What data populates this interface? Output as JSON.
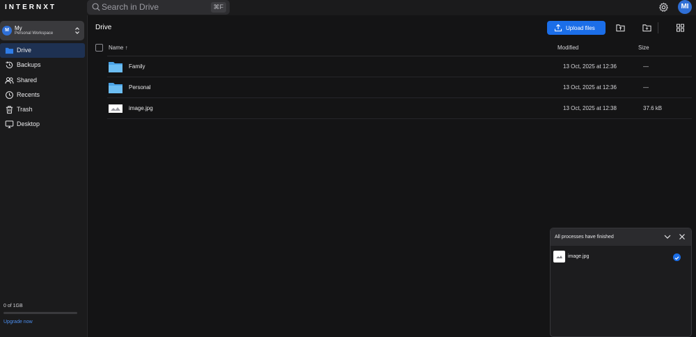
{
  "app": {
    "logo": "INTERNXT"
  },
  "search": {
    "placeholder": "Search in Drive",
    "shortcut": "⌘F"
  },
  "user": {
    "initials": "MI"
  },
  "workspace": {
    "initial": "M",
    "name": "My",
    "subtitle": "Personal Workspace"
  },
  "sidebar": {
    "items": [
      {
        "label": "Drive",
        "icon": "folder-icon",
        "active": true
      },
      {
        "label": "Backups",
        "icon": "history-icon",
        "active": false
      },
      {
        "label": "Shared",
        "icon": "users-icon",
        "active": false
      },
      {
        "label": "Recents",
        "icon": "clock-icon",
        "active": false
      },
      {
        "label": "Trash",
        "icon": "trash-icon",
        "active": false
      },
      {
        "label": "Desktop",
        "icon": "monitor-icon",
        "active": false
      }
    ],
    "storage": "0 of 1GB",
    "upgrade": "Upgrade now"
  },
  "main": {
    "title": "Drive",
    "upload_label": "Upload files",
    "columns": {
      "name": "Name",
      "sort_indicator": "↑",
      "modified": "Modified",
      "size": "Size"
    },
    "rows": [
      {
        "name": "Family",
        "type": "folder",
        "modified": "13 Oct, 2025 at 12:36",
        "size": "—"
      },
      {
        "name": "Personal",
        "type": "folder",
        "modified": "13 Oct, 2025 at 12:36",
        "size": "—"
      },
      {
        "name": "image.jpg",
        "type": "image",
        "modified": "13 Oct, 2025 at 12:38",
        "size": "37.6 kB"
      }
    ]
  },
  "processes": {
    "title": "All processes have finished",
    "items": [
      {
        "name": "image.jpg",
        "status": "done"
      }
    ]
  },
  "colors": {
    "accent": "#1b6ee8",
    "folder": "#5fb3ee",
    "active_nav": "#1e3152"
  }
}
